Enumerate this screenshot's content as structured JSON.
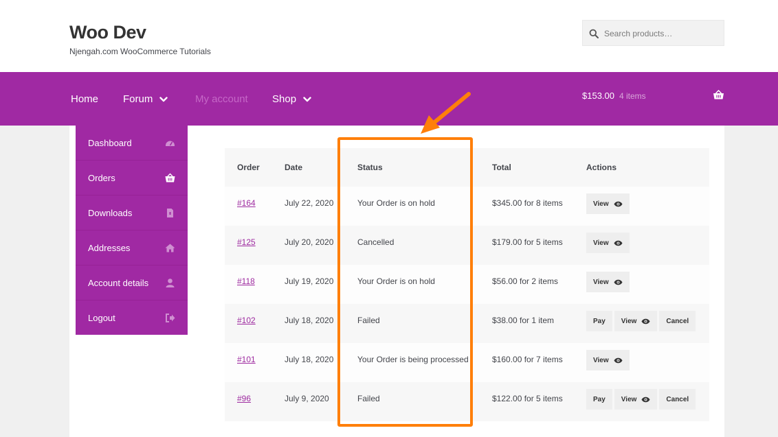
{
  "header": {
    "site_title": "Woo Dev",
    "tagline": "Njengah.com WooCommerce Tutorials",
    "search_placeholder": "Search products…"
  },
  "nav": {
    "items": [
      {
        "label": "Home",
        "has_dropdown": false
      },
      {
        "label": "Forum",
        "has_dropdown": true
      },
      {
        "label": "My account",
        "has_dropdown": false,
        "current": true
      },
      {
        "label": "Shop",
        "has_dropdown": true
      }
    ],
    "cart_total": "$153.00",
    "cart_count": "4 items"
  },
  "account_nav": {
    "items": [
      {
        "label": "Dashboard",
        "icon": "dashboard-icon"
      },
      {
        "label": "Orders",
        "icon": "basket-icon"
      },
      {
        "label": "Downloads",
        "icon": "file-icon"
      },
      {
        "label": "Addresses",
        "icon": "home-icon"
      },
      {
        "label": "Account details",
        "icon": "user-icon"
      },
      {
        "label": "Logout",
        "icon": "logout-icon"
      }
    ]
  },
  "orders": {
    "headers": [
      "Order",
      "Date",
      "Status",
      "Total",
      "Actions"
    ],
    "rows": [
      {
        "order": "#164",
        "date": "July 22, 2020",
        "status": "Your Order is on hold",
        "total": "$345.00 for 8 items",
        "actions": [
          "View"
        ]
      },
      {
        "order": "#125",
        "date": "July 20, 2020",
        "status": "Cancelled",
        "total": "$179.00 for 5 items",
        "actions": [
          "View"
        ]
      },
      {
        "order": "#118",
        "date": "July 19, 2020",
        "status": "Your Order is on hold",
        "total": "$56.00 for 2 items",
        "actions": [
          "View"
        ]
      },
      {
        "order": "#102",
        "date": "July 18, 2020",
        "status": "Failed",
        "total": "$38.00 for 1 item",
        "actions": [
          "Pay",
          "View",
          "Cancel"
        ]
      },
      {
        "order": "#101",
        "date": "July 18, 2020",
        "status": "Your Order is being processed",
        "total": "$160.00 for 7 items",
        "actions": [
          "View"
        ]
      },
      {
        "order": "#96",
        "date": "July 9, 2020",
        "status": "Failed",
        "total": "$122.00 for 5 items",
        "actions": [
          "Pay",
          "View",
          "Cancel"
        ]
      }
    ]
  },
  "colors": {
    "brand_purple": "#a029a3",
    "link_purple": "#9e2ba0",
    "annotation_orange": "#ff7f0a"
  }
}
